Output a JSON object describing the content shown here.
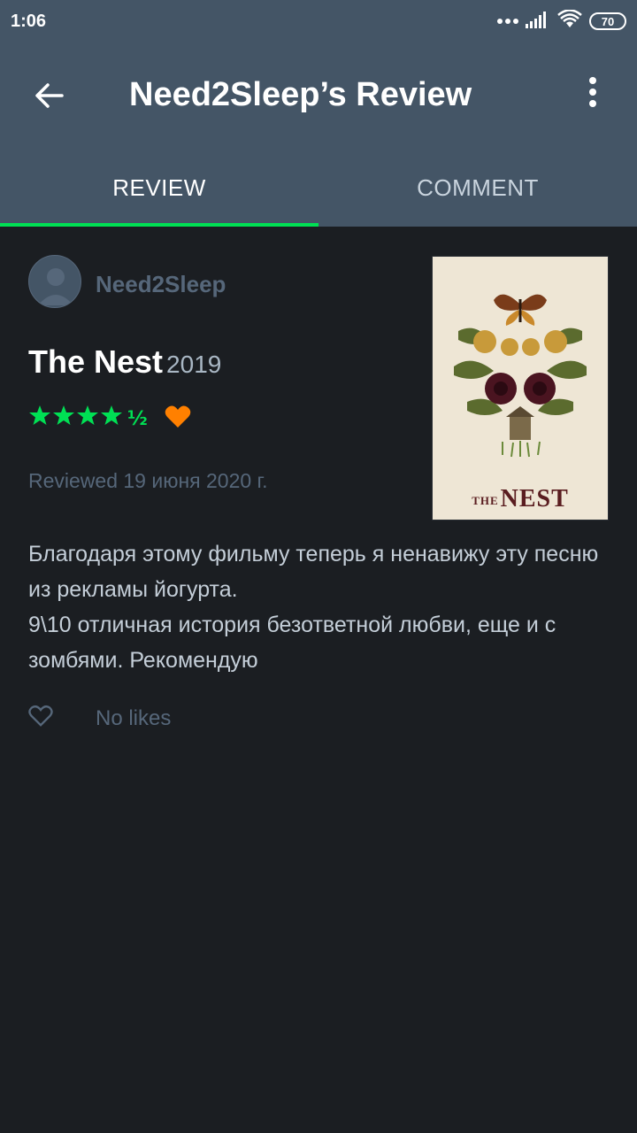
{
  "status_bar": {
    "time": "1:06",
    "battery": "70"
  },
  "header": {
    "title": "Need2Sleep’s Review",
    "back_icon": "arrow-back-icon",
    "menu_icon": "more-vert-icon"
  },
  "tabs": [
    {
      "label": "REVIEW",
      "active": true
    },
    {
      "label": "COMMENT",
      "active": false
    }
  ],
  "review": {
    "username": "Need2Sleep",
    "film_title": "The Nest",
    "film_year": "2019",
    "rating_stars": 4.5,
    "rating_display": "★★★★½",
    "liked": true,
    "reviewed_date": "Reviewed 19 июня 2020 г.",
    "body_lines": [
      "Благодаря этому фильму теперь я ненавижу эту песню из рекламы йогурта.",
      "9\\10 отличная история безответной любви, еще и с зомбями. Рекомендую"
    ],
    "likes_text": "No likes",
    "poster": {
      "title_small": "THE",
      "title_big": "NEST"
    }
  },
  "colors": {
    "accent_green": "#00e054",
    "heart_orange": "#ff8000",
    "header_bg": "#445566",
    "page_bg": "#1b1e22"
  }
}
